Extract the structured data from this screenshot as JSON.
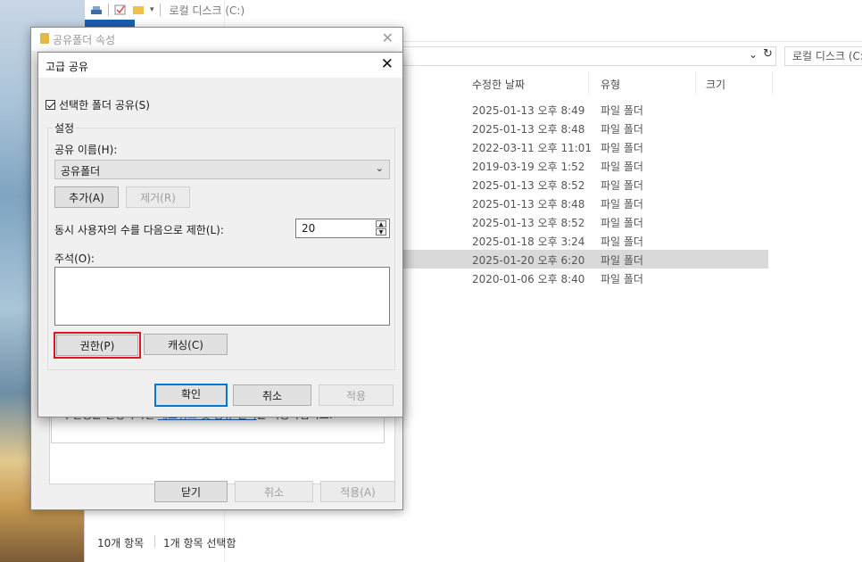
{
  "explorer": {
    "title": "로컬 디스크 (C:)",
    "search_placeholder": "로컬 디스크 (C:)",
    "columns": {
      "date": "수정한 날짜",
      "type": "유형",
      "size": "크기"
    },
    "rows": [
      {
        "date": "2025-01-13 오후 8:49",
        "type": "파일 폴더",
        "selected": false
      },
      {
        "date": "2025-01-13 오후 8:48",
        "type": "파일 폴더",
        "selected": false
      },
      {
        "date": "2022-03-11 오후 11:01",
        "type": "파일 폴더",
        "selected": false
      },
      {
        "date": "2019-03-19 오후 1:52",
        "type": "파일 폴더",
        "selected": false
      },
      {
        "date": "2025-01-13 오후 8:52",
        "type": "파일 폴더",
        "selected": false
      },
      {
        "date": "2025-01-13 오후 8:48",
        "type": "파일 폴더",
        "selected": false
      },
      {
        "date": "2025-01-13 오후 8:52",
        "type": "파일 폴더",
        "selected": false
      },
      {
        "date": "2025-01-18 오후 3:24",
        "type": "파일 폴더",
        "selected": false
      },
      {
        "date": "2025-01-20 오후 6:20",
        "type": "파일 폴더",
        "selected": true
      },
      {
        "date": "2020-01-06 오후 8:40",
        "type": "파일 폴더",
        "selected": false
      }
    ],
    "status": {
      "item_count": "10개 항목",
      "selected_count": "1개 항목 선택함"
    }
  },
  "properties_dialog": {
    "title": "공유폴더 속성",
    "link_text_prefix": "이 설정을 변경하려면 ",
    "link_text": "네트워크 및 공유 센터",
    "link_text_suffix": "를 사용하십시오.",
    "close_label": "닫기",
    "cancel_label": "취소",
    "apply_label": "적용(A)"
  },
  "advanced_sharing": {
    "title": "고급 공유",
    "share_checkbox_label": "선택한 폴더 공유(S)",
    "share_checked": true,
    "settings_legend": "설정",
    "share_name_label": "공유 이름(H):",
    "share_name_value": "공유폴더",
    "add_label": "추가(A)",
    "remove_label": "제거(R)",
    "user_limit_label": "동시 사용자의 수를 다음으로 제한(L):",
    "user_limit_value": "20",
    "comment_label": "주석(O):",
    "permissions_label": "권한(P)",
    "caching_label": "캐싱(C)",
    "ok_label": "확인",
    "cancel_label": "취소",
    "apply_label": "적용"
  },
  "colors": {
    "accent": "#0078d7",
    "highlight": "#e0161d",
    "selection": "#d9d9d9"
  }
}
